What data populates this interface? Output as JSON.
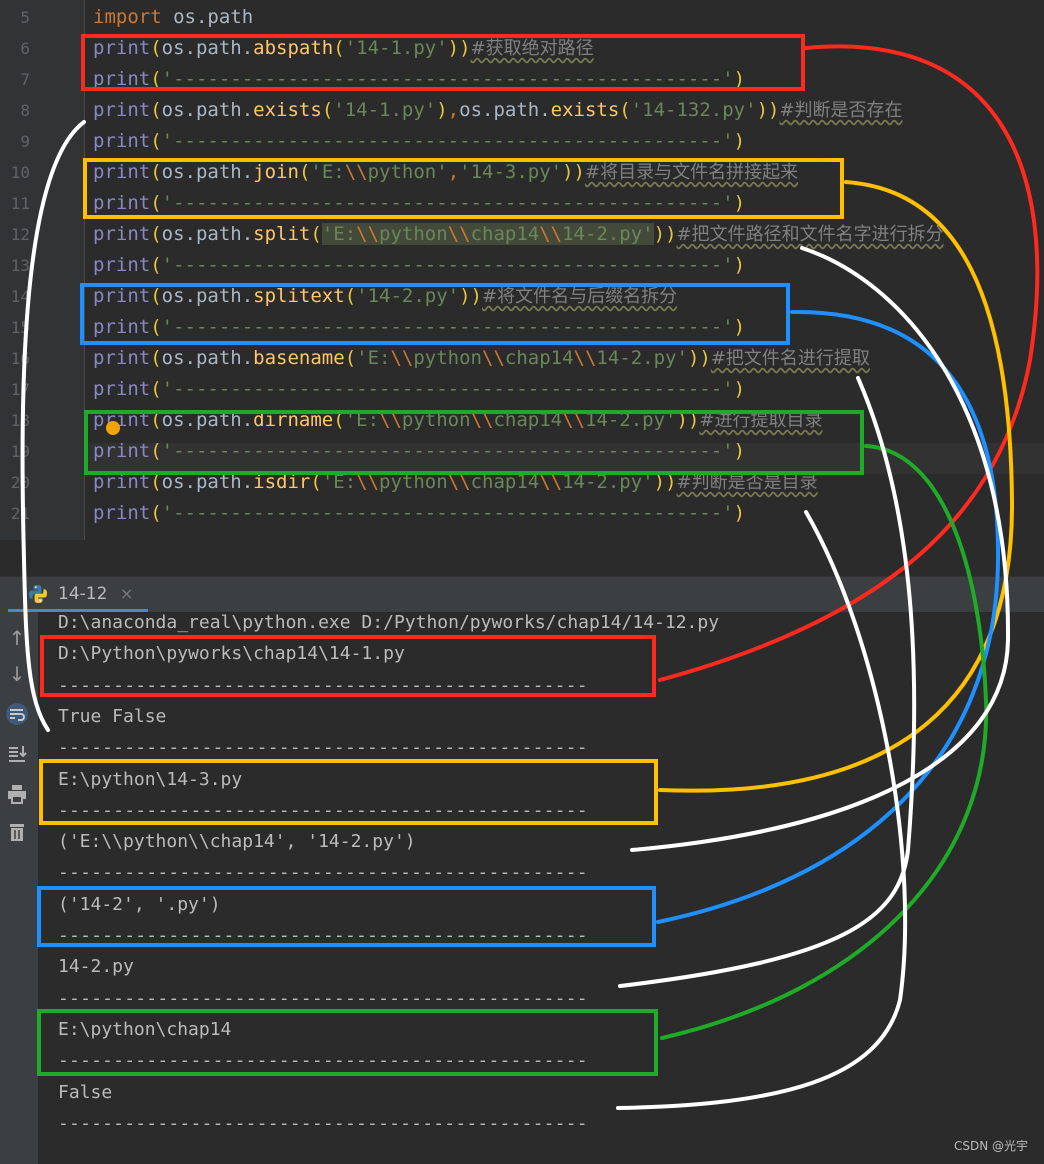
{
  "editor": {
    "line_numbers": [
      "5",
      "6",
      "7",
      "8",
      "9",
      "10",
      "11",
      "12",
      "13",
      "14",
      "15",
      "16",
      "17",
      "18",
      "19",
      "20",
      "21"
    ],
    "lines": [
      {
        "parts": [
          {
            "t": "import",
            "c": "kw"
          },
          {
            "t": " os.path",
            "c": "obj"
          }
        ]
      },
      {
        "parts": [
          {
            "t": "print",
            "c": "fn"
          },
          {
            "t": "(",
            "c": "p"
          },
          {
            "t": "os.path.",
            "c": "obj"
          },
          {
            "t": "abspath",
            "c": "call"
          },
          {
            "t": "(",
            "c": "p"
          },
          {
            "t": "'14-1.py'",
            "c": "str"
          },
          {
            "t": "))",
            "c": "p"
          },
          {
            "t": "#获取绝对路径",
            "c": "com"
          }
        ]
      },
      {
        "parts": [
          {
            "t": "print",
            "c": "fn"
          },
          {
            "t": "(",
            "c": "p"
          },
          {
            "t": "'------------------------------------------------'",
            "c": "str"
          },
          {
            "t": ")",
            "c": "p"
          }
        ]
      },
      {
        "parts": [
          {
            "t": "print",
            "c": "fn"
          },
          {
            "t": "(",
            "c": "p"
          },
          {
            "t": "os.path.",
            "c": "obj"
          },
          {
            "t": "exists",
            "c": "call"
          },
          {
            "t": "(",
            "c": "p"
          },
          {
            "t": "'14-1.py'",
            "c": "str"
          },
          {
            "t": ")",
            "c": "p"
          },
          {
            "t": ",",
            "c": "kw"
          },
          {
            "t": "os.path.",
            "c": "obj"
          },
          {
            "t": "exists",
            "c": "call"
          },
          {
            "t": "(",
            "c": "p"
          },
          {
            "t": "'14-132.py'",
            "c": "str"
          },
          {
            "t": "))",
            "c": "p"
          },
          {
            "t": "#判断是否存在",
            "c": "com"
          }
        ]
      },
      {
        "parts": [
          {
            "t": "print",
            "c": "fn"
          },
          {
            "t": "(",
            "c": "p"
          },
          {
            "t": "'------------------------------------------------'",
            "c": "str"
          },
          {
            "t": ")",
            "c": "p"
          }
        ]
      },
      {
        "parts": [
          {
            "t": "print",
            "c": "fn"
          },
          {
            "t": "(",
            "c": "p"
          },
          {
            "t": "os.path.",
            "c": "obj"
          },
          {
            "t": "join",
            "c": "call"
          },
          {
            "t": "(",
            "c": "p"
          },
          {
            "t": "'E:",
            "c": "str"
          },
          {
            "t": "\\\\",
            "c": "esc"
          },
          {
            "t": "python'",
            "c": "str"
          },
          {
            "t": ",",
            "c": "kw"
          },
          {
            "t": "'14-3.py'",
            "c": "str"
          },
          {
            "t": "))",
            "c": "p"
          },
          {
            "t": "#将目录与文件名拼接起来",
            "c": "com"
          }
        ]
      },
      {
        "parts": [
          {
            "t": "print",
            "c": "fn"
          },
          {
            "t": "(",
            "c": "p"
          },
          {
            "t": "'------------------------------------------------'",
            "c": "str"
          },
          {
            "t": ")",
            "c": "p"
          }
        ]
      },
      {
        "parts": [
          {
            "t": "print",
            "c": "fn"
          },
          {
            "t": "(",
            "c": "p"
          },
          {
            "t": "os.path.",
            "c": "obj"
          },
          {
            "t": "split",
            "c": "call"
          },
          {
            "t": "(",
            "c": "p"
          },
          {
            "t": "'E:",
            "c": "str hl-str"
          },
          {
            "t": "\\\\",
            "c": "esc hl-str"
          },
          {
            "t": "python",
            "c": "str hl-str"
          },
          {
            "t": "\\\\",
            "c": "esc hl-str"
          },
          {
            "t": "chap14",
            "c": "str hl-str"
          },
          {
            "t": "\\\\",
            "c": "esc hl-str"
          },
          {
            "t": "14-2.py'",
            "c": "str hl-str"
          },
          {
            "t": "))",
            "c": "p"
          },
          {
            "t": "#把文件路径和文件名字进行拆分",
            "c": "com"
          }
        ]
      },
      {
        "parts": [
          {
            "t": "print",
            "c": "fn"
          },
          {
            "t": "(",
            "c": "p"
          },
          {
            "t": "'------------------------------------------------'",
            "c": "str"
          },
          {
            "t": ")",
            "c": "p"
          }
        ]
      },
      {
        "parts": [
          {
            "t": "print",
            "c": "fn"
          },
          {
            "t": "(",
            "c": "p"
          },
          {
            "t": "os.path.",
            "c": "obj"
          },
          {
            "t": "splitext",
            "c": "call"
          },
          {
            "t": "(",
            "c": "p"
          },
          {
            "t": "'14-2.py'",
            "c": "str"
          },
          {
            "t": "))",
            "c": "p"
          },
          {
            "t": "#将文件名与后缀名拆分",
            "c": "com"
          }
        ]
      },
      {
        "parts": [
          {
            "t": "print",
            "c": "fn"
          },
          {
            "t": "(",
            "c": "p"
          },
          {
            "t": "'------------------------------------------------'",
            "c": "str"
          },
          {
            "t": ")",
            "c": "p"
          }
        ]
      },
      {
        "parts": [
          {
            "t": "print",
            "c": "fn"
          },
          {
            "t": "(",
            "c": "p"
          },
          {
            "t": "os.path.",
            "c": "obj"
          },
          {
            "t": "basename",
            "c": "call"
          },
          {
            "t": "(",
            "c": "p"
          },
          {
            "t": "'E:",
            "c": "str"
          },
          {
            "t": "\\\\",
            "c": "esc"
          },
          {
            "t": "python",
            "c": "str"
          },
          {
            "t": "\\\\",
            "c": "esc"
          },
          {
            "t": "chap14",
            "c": "str"
          },
          {
            "t": "\\\\",
            "c": "esc"
          },
          {
            "t": "14-2.py'",
            "c": "str"
          },
          {
            "t": "))",
            "c": "p"
          },
          {
            "t": "#把文件名进行提取",
            "c": "com"
          }
        ]
      },
      {
        "parts": [
          {
            "t": "print",
            "c": "fn"
          },
          {
            "t": "(",
            "c": "p"
          },
          {
            "t": "'------------------------------------------------'",
            "c": "str"
          },
          {
            "t": ")",
            "c": "p"
          }
        ]
      },
      {
        "parts": [
          {
            "t": "print",
            "c": "fn"
          },
          {
            "t": "(",
            "c": "p"
          },
          {
            "t": "os.path.",
            "c": "obj"
          },
          {
            "t": "dirname",
            "c": "call"
          },
          {
            "t": "(",
            "c": "p"
          },
          {
            "t": "'E:",
            "c": "str"
          },
          {
            "t": "\\\\",
            "c": "esc"
          },
          {
            "t": "python",
            "c": "str"
          },
          {
            "t": "\\\\",
            "c": "esc"
          },
          {
            "t": "chap14",
            "c": "str"
          },
          {
            "t": "\\\\",
            "c": "esc"
          },
          {
            "t": "14-2.py'",
            "c": "str"
          },
          {
            "t": "))",
            "c": "p"
          },
          {
            "t": "#进行提取目录",
            "c": "com"
          }
        ]
      },
      {
        "parts": [
          {
            "t": "print",
            "c": "fn"
          },
          {
            "t": "(",
            "c": "p"
          },
          {
            "t": "'------------------------------------------------'",
            "c": "str"
          },
          {
            "t": ")",
            "c": "p"
          }
        ]
      },
      {
        "parts": [
          {
            "t": "print",
            "c": "fn"
          },
          {
            "t": "(",
            "c": "p"
          },
          {
            "t": "os.path.",
            "c": "obj"
          },
          {
            "t": "isdir",
            "c": "call"
          },
          {
            "t": "(",
            "c": "p"
          },
          {
            "t": "'E:",
            "c": "str"
          },
          {
            "t": "\\\\",
            "c": "esc"
          },
          {
            "t": "python",
            "c": "str"
          },
          {
            "t": "\\\\",
            "c": "esc"
          },
          {
            "t": "chap14",
            "c": "str"
          },
          {
            "t": "\\\\",
            "c": "esc"
          },
          {
            "t": "14-2.py'",
            "c": "str"
          },
          {
            "t": "))",
            "c": "p"
          },
          {
            "t": "#判断是否是目录",
            "c": "com"
          }
        ]
      },
      {
        "parts": [
          {
            "t": "print",
            "c": "fn"
          },
          {
            "t": "(",
            "c": "p"
          },
          {
            "t": "'------------------------------------------------'",
            "c": "str"
          },
          {
            "t": ")",
            "c": "p"
          }
        ]
      }
    ]
  },
  "run_panel": {
    "tab_label": "14-12",
    "close_glyph": "×",
    "icons": [
      "rerun-up-icon",
      "arrow-down-icon",
      "soft-wrap-icon",
      "scroll-to-end-icon",
      "print-icon",
      "trash-icon"
    ]
  },
  "console": {
    "lines": [
      "D:\\anaconda_real\\python.exe D:/Python/pyworks/chap14/14-12.py",
      "D:\\Python\\pyworks\\chap14\\14-1.py",
      "------------------------------------------------",
      "True False",
      "------------------------------------------------",
      "E:\\python\\14-3.py",
      "------------------------------------------------",
      "('E:\\\\python\\\\chap14', '14-2.py')",
      "------------------------------------------------",
      "('14-2', '.py')",
      "------------------------------------------------",
      "14-2.py",
      "------------------------------------------------",
      "E:\\python\\chap14",
      "------------------------------------------------",
      "False",
      "------------------------------------------------"
    ]
  },
  "watermark": "CSDN @光宇",
  "annotation_colors": {
    "red": "#ff2a1f",
    "yellow": "#ffc000",
    "blue": "#1e90ff",
    "green": "#1faa28",
    "white": "#ffffff"
  }
}
